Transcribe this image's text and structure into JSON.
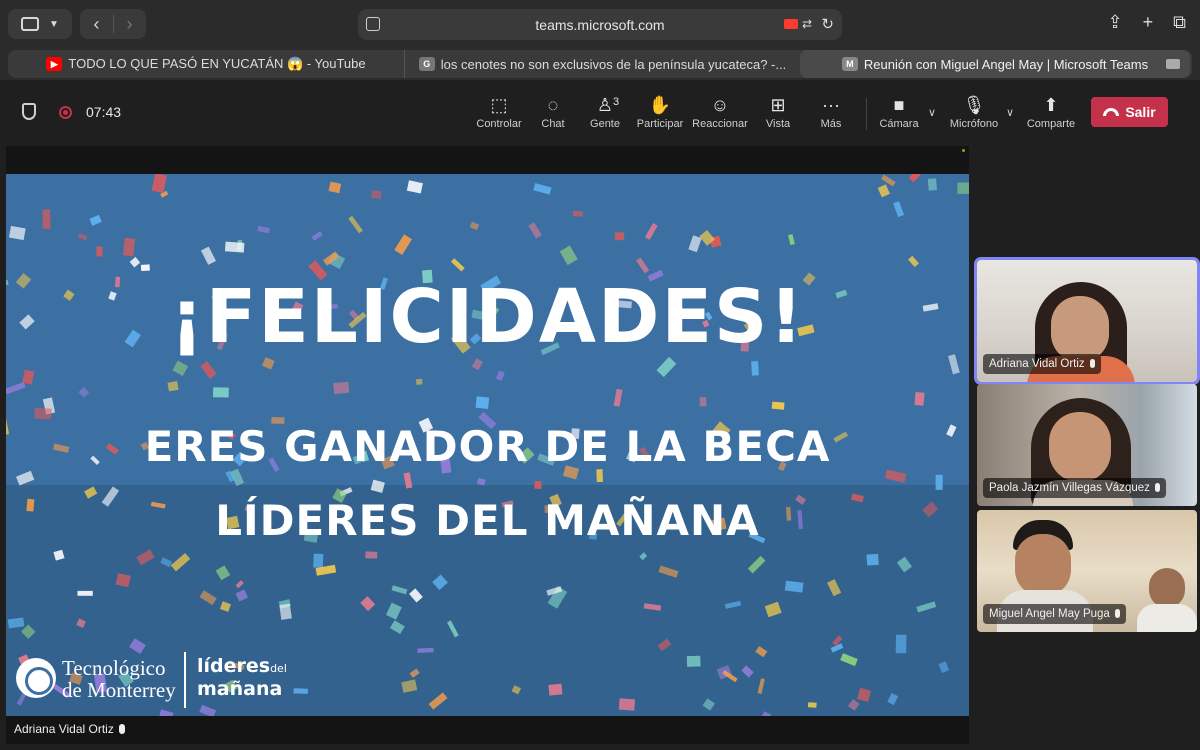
{
  "browser": {
    "url": "teams.microsoft.com",
    "tabs": [
      {
        "favicon": "youtube-icon",
        "title": "TODO LO QUE PASÓ EN YUCATÁN 😱 - YouTube"
      },
      {
        "favicon": "g-icon",
        "favicon_text": "G",
        "title": "los cenotes no son exclusivos de la península yucateca? -..."
      },
      {
        "favicon": "m-icon",
        "favicon_text": "M",
        "title": "Reunión con Miguel Angel May | Microsoft Teams"
      }
    ]
  },
  "meeting": {
    "timer": "07:43",
    "tools": [
      {
        "label": "Controlar",
        "icon": "share-control-icon"
      },
      {
        "label": "Chat",
        "icon": "chat-icon"
      },
      {
        "label": "Gente",
        "icon": "people-icon",
        "count": "3"
      },
      {
        "label": "Participar",
        "icon": "raise-hand-icon"
      },
      {
        "label": "Reaccionar",
        "icon": "emoji-icon"
      },
      {
        "label": "Vista",
        "icon": "view-grid-icon"
      },
      {
        "label": "Más",
        "icon": "more-icon"
      },
      {
        "label": "Cámara",
        "icon": "camera-icon"
      },
      {
        "label": "Micrófono",
        "icon": "microphone-icon"
      },
      {
        "label": "Comparte",
        "icon": "share-screen-icon"
      }
    ],
    "leave_label": "Salir",
    "accent": "#c4314b"
  },
  "slide": {
    "headline": "¡FELICIDADES!",
    "line1": "ERES GANADOR DE LA BECA",
    "line2": "LÍDERES DEL MAÑANA",
    "logo_tec_line1": "Tecnológico",
    "logo_tec_line2": "de Monterrey",
    "logo_lideres_line1": "líderes",
    "logo_lideres_small": "del",
    "logo_lideres_line2": "mañana",
    "background": "#3c6fa2"
  },
  "stage_name": "Adriana Vidal Ortiz",
  "participants": [
    {
      "name": "Adriana Vidal Ortiz",
      "active": true
    },
    {
      "name": "Paola Jazmín Villegas Vázquez",
      "active": false
    },
    {
      "name": "Miguel Angel May Puga",
      "active": false
    }
  ]
}
